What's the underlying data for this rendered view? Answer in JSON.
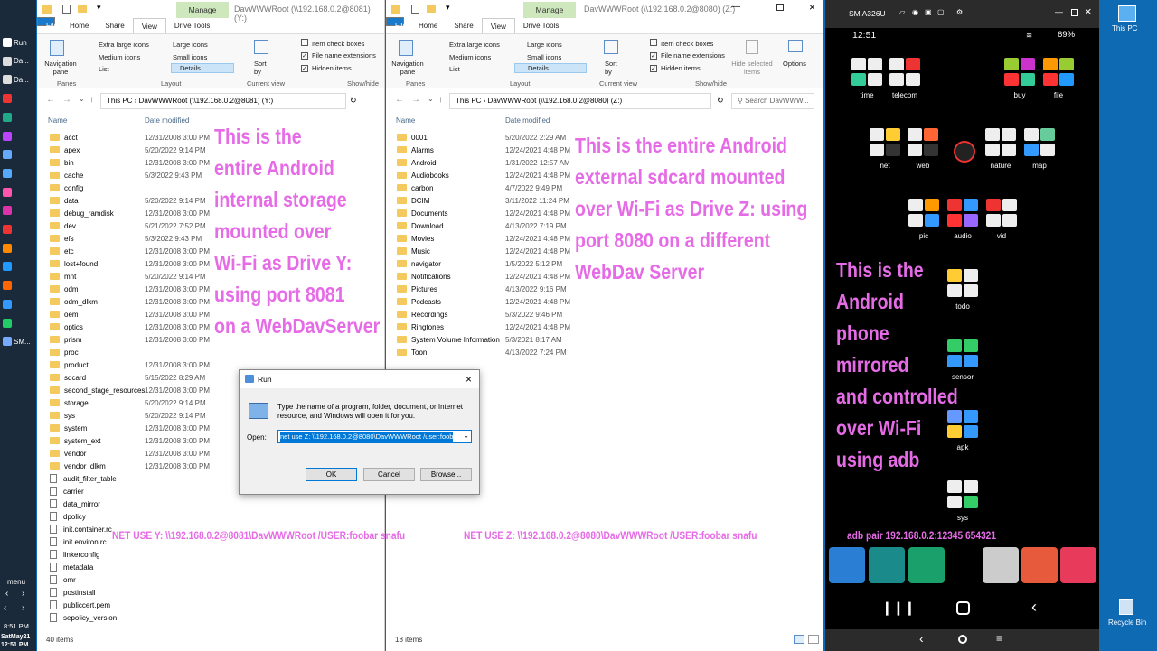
{
  "taskbar": {
    "items": [
      {
        "label": "Run"
      },
      {
        "label": "Da..."
      },
      {
        "label": "Da..."
      },
      {
        "label": ""
      },
      {
        "label": ""
      },
      {
        "label": ""
      },
      {
        "label": ""
      },
      {
        "label": ""
      },
      {
        "label": ""
      },
      {
        "label": ""
      },
      {
        "label": ""
      },
      {
        "label": ""
      },
      {
        "label": ""
      },
      {
        "label": ""
      },
      {
        "label": ""
      },
      {
        "label": ""
      },
      {
        "label": "SM..."
      }
    ],
    "menu": "menu",
    "time": "8:51 PM",
    "date": "SatMay21",
    "clock": "12:51 PM"
  },
  "left_window": {
    "title": "DavWWWRoot (\\\\192.168.0.2@8081) (Y:)",
    "manage": "Manage",
    "tabs": [
      "File",
      "Home",
      "Share",
      "View",
      "Drive Tools"
    ],
    "ribbon": {
      "navigation_pane": "Navigation pane",
      "layout_items": [
        "Extra large icons",
        "Large icons",
        "Medium icons",
        "Small icons",
        "List",
        "Details"
      ],
      "sort_by": "Sort by",
      "show_hide": [
        "Item check boxes",
        "File name extensions",
        "Hidden items"
      ],
      "groups": [
        "Panes",
        "Layout",
        "Current view",
        "Show/hide"
      ]
    },
    "breadcrumb": "This PC  ›  DavWWWRoot (\\\\192.168.0.2@8081) (Y:)",
    "col_name": "Name",
    "col_date": "Date modified",
    "rows": [
      {
        "name": "acct",
        "date": "12/31/2008 3:00 PM",
        "type": "folder"
      },
      {
        "name": "apex",
        "date": "5/20/2022 9:14 PM",
        "type": "folder"
      },
      {
        "name": "bin",
        "date": "12/31/2008 3:00 PM",
        "type": "folder"
      },
      {
        "name": "cache",
        "date": "5/3/2022 9:43 PM",
        "type": "folder"
      },
      {
        "name": "config",
        "date": "",
        "type": "folder"
      },
      {
        "name": "data",
        "date": "5/20/2022 9:14 PM",
        "type": "folder"
      },
      {
        "name": "debug_ramdisk",
        "date": "12/31/2008 3:00 PM",
        "type": "folder"
      },
      {
        "name": "dev",
        "date": "5/21/2022 7:52 PM",
        "type": "folder"
      },
      {
        "name": "efs",
        "date": "5/3/2022 9:43 PM",
        "type": "folder"
      },
      {
        "name": "etc",
        "date": "12/31/2008 3:00 PM",
        "type": "folder"
      },
      {
        "name": "lost+found",
        "date": "12/31/2008 3:00 PM",
        "type": "folder"
      },
      {
        "name": "mnt",
        "date": "5/20/2022 9:14 PM",
        "type": "folder"
      },
      {
        "name": "odm",
        "date": "12/31/2008 3:00 PM",
        "type": "folder"
      },
      {
        "name": "odm_dlkm",
        "date": "12/31/2008 3:00 PM",
        "type": "folder"
      },
      {
        "name": "oem",
        "date": "12/31/2008 3:00 PM",
        "type": "folder"
      },
      {
        "name": "optics",
        "date": "12/31/2008 3:00 PM",
        "type": "folder"
      },
      {
        "name": "prism",
        "date": "12/31/2008 3:00 PM",
        "type": "folder"
      },
      {
        "name": "proc",
        "date": "",
        "type": "folder"
      },
      {
        "name": "product",
        "date": "12/31/2008 3:00 PM",
        "type": "folder"
      },
      {
        "name": "sdcard",
        "date": "5/15/2022 8:29 AM",
        "type": "folder"
      },
      {
        "name": "second_stage_resources",
        "date": "12/31/2008 3:00 PM",
        "type": "folder"
      },
      {
        "name": "storage",
        "date": "5/20/2022 9:14 PM",
        "type": "folder"
      },
      {
        "name": "sys",
        "date": "5/20/2022 9:14 PM",
        "type": "folder"
      },
      {
        "name": "system",
        "date": "12/31/2008 3:00 PM",
        "type": "folder"
      },
      {
        "name": "system_ext",
        "date": "12/31/2008 3:00 PM",
        "type": "folder"
      },
      {
        "name": "vendor",
        "date": "12/31/2008 3:00 PM",
        "type": "folder"
      },
      {
        "name": "vendor_dlkm",
        "date": "12/31/2008 3:00 PM",
        "type": "folder"
      },
      {
        "name": "audit_filter_table",
        "date": "",
        "type": "file"
      },
      {
        "name": "carrier",
        "date": "",
        "type": "file"
      },
      {
        "name": "data_mirror",
        "date": "",
        "type": "file"
      },
      {
        "name": "dpolicy",
        "date": "",
        "type": "file"
      },
      {
        "name": "init.container.rc",
        "date": "",
        "type": "file"
      },
      {
        "name": "init.environ.rc",
        "date": "",
        "type": "file"
      },
      {
        "name": "linkerconfig",
        "date": "",
        "type": "file"
      },
      {
        "name": "metadata",
        "date": "",
        "type": "file"
      },
      {
        "name": "omr",
        "date": "",
        "type": "file"
      },
      {
        "name": "postinstall",
        "date": "",
        "type": "file"
      },
      {
        "name": "publiccert.pem",
        "date": "",
        "type": "file"
      },
      {
        "name": "sepolicy_version",
        "date": "",
        "type": "file"
      }
    ],
    "status": "40 items",
    "overlay": [
      "This is the",
      "entire Android",
      "internal storage",
      "mounted over",
      "Wi-Fi as Drive Y:",
      "using port 8081",
      "on a WebDavServer"
    ],
    "command": "NET USE Y: \\\\192.168.0.2@8081\\DavWWWRoot /USER:foobar snafu"
  },
  "right_window": {
    "title": "DavWWWRoot (\\\\192.168.0.2@8080) (Z:)",
    "manage": "Manage",
    "tabs": [
      "File",
      "Home",
      "Share",
      "View",
      "Drive Tools"
    ],
    "ribbon": {
      "navigation_pane": "Navigation pane",
      "layout_items": [
        "Extra large icons",
        "Large icons",
        "Medium icons",
        "Small icons",
        "List",
        "Details"
      ],
      "sort_by": "Sort by",
      "show_hide": [
        "Item check boxes",
        "File name extensions",
        "Hidden items"
      ],
      "hide_selected": "Hide selected items",
      "options": "Options",
      "groups": [
        "Panes",
        "Layout",
        "Current view",
        "Show/hide"
      ]
    },
    "breadcrumb": "This PC  ›  DavWWWRoot (\\\\192.168.0.2@8080) (Z:)",
    "search_placeholder": "Search DavWWW...",
    "col_name": "Name",
    "col_date": "Date modified",
    "rows": [
      {
        "name": "0001",
        "date": "5/20/2022 2:29 AM"
      },
      {
        "name": "Alarms",
        "date": "12/24/2021 4:48 PM"
      },
      {
        "name": "Android",
        "date": "1/31/2022 12:57 AM"
      },
      {
        "name": "Audiobooks",
        "date": "12/24/2021 4:48 PM"
      },
      {
        "name": "carbon",
        "date": "4/7/2022 9:49 PM"
      },
      {
        "name": "DCIM",
        "date": "3/11/2022 11:24 PM"
      },
      {
        "name": "Documents",
        "date": "12/24/2021 4:48 PM"
      },
      {
        "name": "Download",
        "date": "4/13/2022 7:19 PM"
      },
      {
        "name": "Movies",
        "date": "12/24/2021 4:48 PM"
      },
      {
        "name": "Music",
        "date": "12/24/2021 4:48 PM"
      },
      {
        "name": "navigator",
        "date": "1/5/2022 5:12 PM"
      },
      {
        "name": "Notifications",
        "date": "12/24/2021 4:48 PM"
      },
      {
        "name": "Pictures",
        "date": "4/13/2022 9:16 PM"
      },
      {
        "name": "Podcasts",
        "date": "12/24/2021 4:48 PM"
      },
      {
        "name": "Recordings",
        "date": "5/3/2022 9:46 PM"
      },
      {
        "name": "Ringtones",
        "date": "12/24/2021 4:48 PM"
      },
      {
        "name": "System Volume Information",
        "date": "5/3/2021 8:17 AM"
      },
      {
        "name": "Toon",
        "date": "4/13/2022 7:24 PM"
      }
    ],
    "status": "18 items",
    "overlay": [
      "This is the entire Android",
      "external sdcard mounted",
      "over Wi-Fi as Drive Z: using",
      "port 8080 on a different",
      "WebDav Server"
    ],
    "command": "NET USE Z: \\\\192.168.0.2@8080\\DavWWWRoot /USER:foobar snafu"
  },
  "run_dialog": {
    "title": "Run",
    "description": "Type the name of a program, folder, document, or Internet resource, and Windows will open it for you.",
    "open_label": "Open:",
    "open_value": "net use Z: \\\\192.168.0.2@8080\\DavWWWRoot /user:foob",
    "ok": "OK",
    "cancel": "Cancel",
    "browse": "Browse..."
  },
  "phone": {
    "window_title": "SM A326U",
    "time": "12:51",
    "battery": "69%",
    "folders": [
      {
        "label": "time"
      },
      {
        "label": "telecom"
      },
      {
        "label": "buy"
      },
      {
        "label": "file"
      },
      {
        "label": "net"
      },
      {
        "label": "web"
      },
      {
        "label": "nature"
      },
      {
        "label": "map"
      },
      {
        "label": "pic"
      },
      {
        "label": "audio"
      },
      {
        "label": "vid"
      },
      {
        "label": "todo"
      },
      {
        "label": "sensor"
      },
      {
        "label": "apk"
      },
      {
        "label": "sys"
      }
    ],
    "overlay": [
      "This is the",
      "Android",
      "phone",
      "mirrored",
      "and controlled",
      "over Wi-Fi",
      "using adb"
    ],
    "adb": "adb pair 192.168.0.2:12345 654321"
  },
  "desktop": {
    "this_pc": "This PC",
    "recycle_bin": "Recycle Bin"
  },
  "colors": {
    "overlay": "#e66be6",
    "file_tab": "#1979ca",
    "manage": "#cfe7bd",
    "desktop": "#0f6ab4"
  }
}
